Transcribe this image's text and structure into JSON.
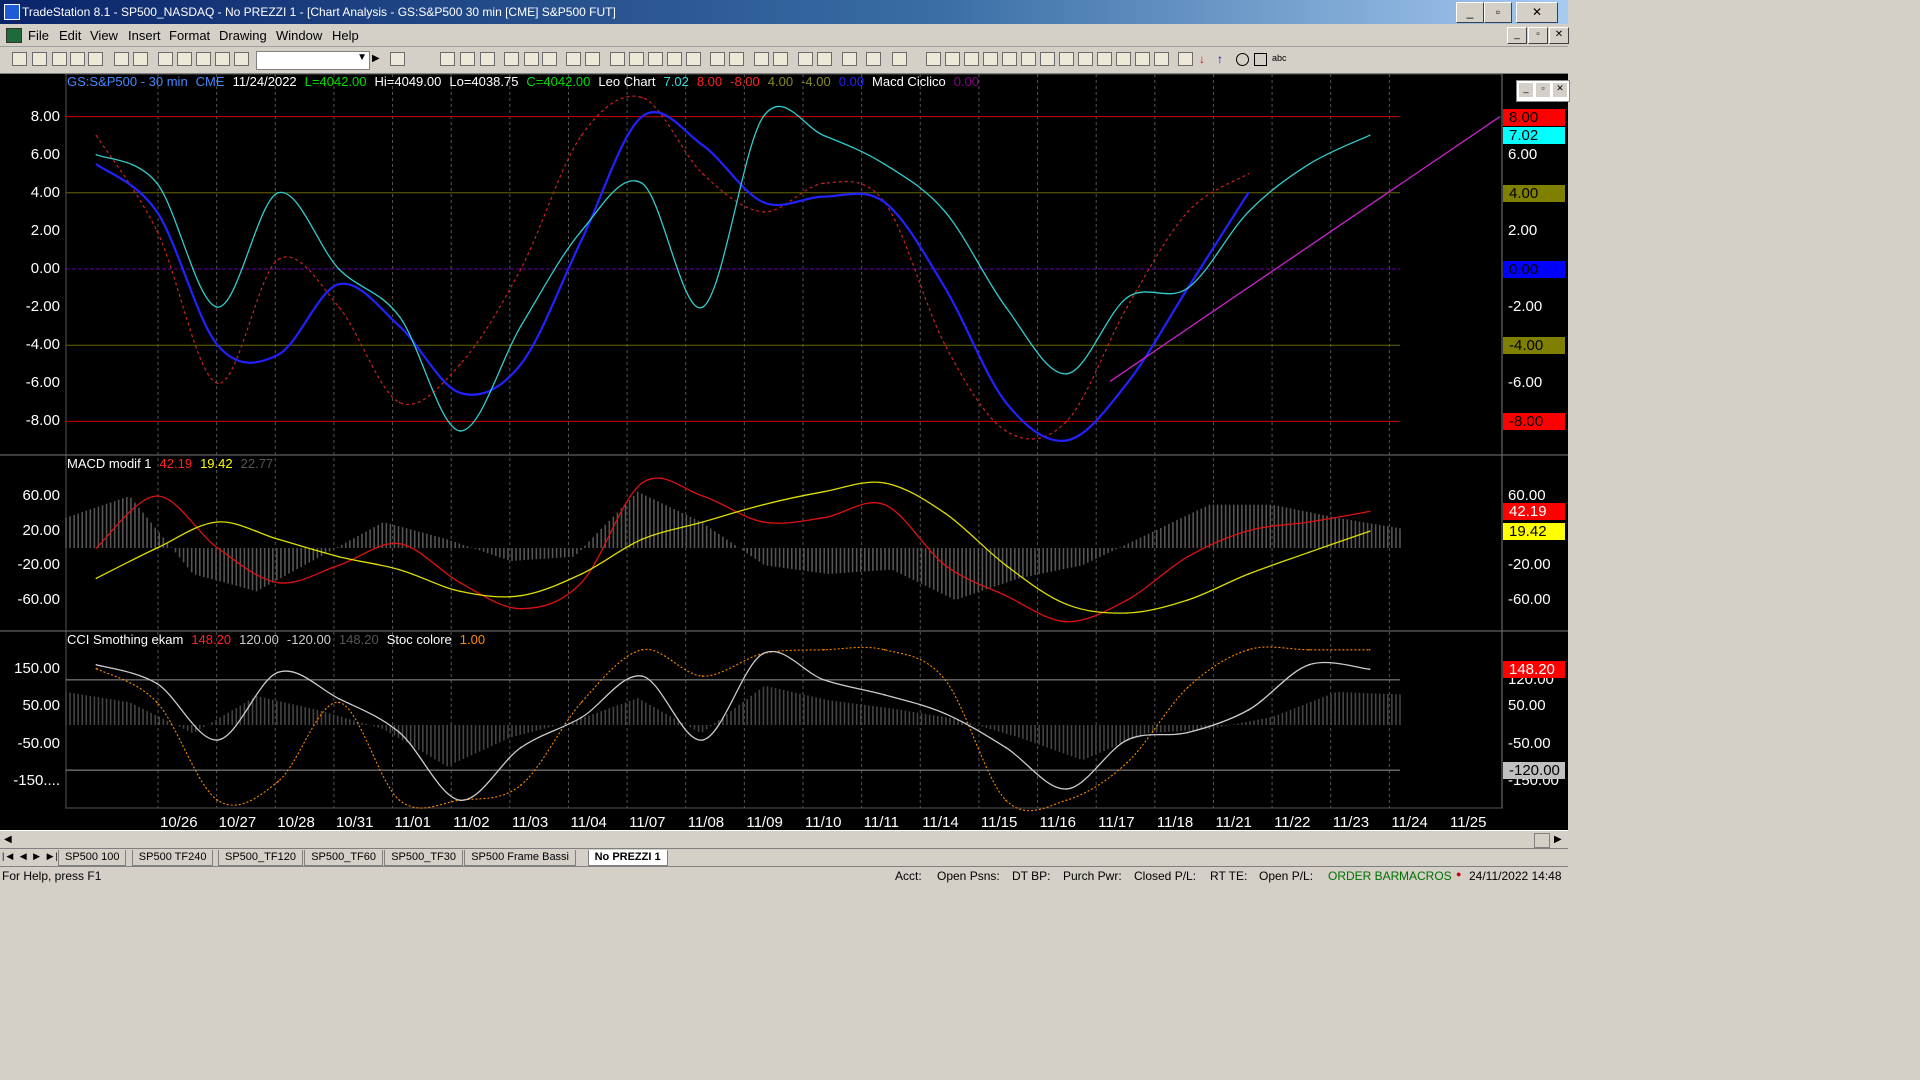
{
  "window": {
    "title": "TradeStation 8.1 - SP500_NASDAQ - No PREZZI 1 - [Chart Analysis - GS:S&P500  30 min  [CME] S&P500 FUT]"
  },
  "menu": [
    "File",
    "Edit",
    "View",
    "Insert",
    "Format",
    "Drawing",
    "Window",
    "Help"
  ],
  "pane1": {
    "labels": [
      {
        "text": "GS:S&P500 - 30 min",
        "color": "#4488ff"
      },
      {
        "text": "CME",
        "color": "#4488ff"
      },
      {
        "text": "11/24/2022",
        "color": "#ffffff"
      },
      {
        "text": "L=4042.00",
        "color": "#00dd00"
      },
      {
        "text": "Hi=4049.00",
        "color": "#ffffff"
      },
      {
        "text": "Lo=4038.75",
        "color": "#ffffff"
      },
      {
        "text": "C=4042.00",
        "color": "#00dd00"
      },
      {
        "text": "Leo Chart",
        "color": "#ffffff"
      },
      {
        "text": "7.02",
        "color": "#33dddd"
      },
      {
        "text": "8.00",
        "color": "#ff2222"
      },
      {
        "text": "-8.00",
        "color": "#ff2222"
      },
      {
        "text": "4.00",
        "color": "#888822"
      },
      {
        "text": "-4.00",
        "color": "#888822"
      },
      {
        "text": "0.00",
        "color": "#2222ff"
      },
      {
        "text": "Macd Ciclico",
        "color": "#ffffff"
      },
      {
        "text": "0.00",
        "color": "#880088"
      }
    ],
    "y_ticks": [
      "8.00",
      "6.00",
      "4.00",
      "2.00",
      "0.00",
      "-2.00",
      "-4.00",
      "-6.00",
      "-8.00"
    ],
    "right_ticks": [
      "6.00",
      "2.00",
      "-2.00",
      "-6.00"
    ],
    "tags": [
      {
        "text": "8.00",
        "bg": "#ff0000",
        "fg": "#000000"
      },
      {
        "text": "7.02",
        "bg": "#00ffff",
        "fg": "#000000"
      },
      {
        "text": "4.00",
        "bg": "#808000",
        "fg": "#000000"
      },
      {
        "text": "0.00",
        "bg": "#0000ff",
        "fg": "#000000"
      },
      {
        "text": "-4.00",
        "bg": "#808000",
        "fg": "#000000"
      },
      {
        "text": "-8.00",
        "bg": "#ff0000",
        "fg": "#000000"
      }
    ]
  },
  "pane2": {
    "labels": [
      {
        "text": "MACD modif 1",
        "color": "#ffffff"
      },
      {
        "text": "42.19",
        "color": "#ff2222"
      },
      {
        "text": "19.42",
        "color": "#ffff00"
      },
      {
        "text": "22.77",
        "color": "#555555"
      }
    ],
    "y_ticks": [
      "60.00",
      "20.00",
      "-20.00",
      "-60.00"
    ],
    "right_ticks": [
      "60.00",
      "-20.00",
      "-60.00"
    ],
    "tags": [
      {
        "text": "42.19",
        "bg": "#ff0000",
        "fg": "#ffffff"
      },
      {
        "text": "19.42",
        "bg": "#ffff00",
        "fg": "#000000"
      }
    ]
  },
  "pane3": {
    "labels": [
      {
        "text": "CCI Smothing ekam",
        "color": "#ffffff"
      },
      {
        "text": "148.20",
        "color": "#ff2222"
      },
      {
        "text": "120.00",
        "color": "#cccccc"
      },
      {
        "text": "-120.00",
        "color": "#cccccc"
      },
      {
        "text": "148.20",
        "color": "#555555"
      },
      {
        "text": "Stoc colore",
        "color": "#ffffff"
      },
      {
        "text": "1.00",
        "color": "#ff8800"
      }
    ],
    "y_ticks": [
      "150.00",
      "50.00",
      "-50.00",
      "-150...."
    ],
    "right_ticks": [
      "120.00",
      "50.00",
      "-50.00",
      "-150.00"
    ],
    "tags": [
      {
        "text": "148.20",
        "bg": "#ff0000",
        "fg": "#ffffff"
      },
      {
        "text": "-120.00",
        "bg": "#c0c0c0",
        "fg": "#000000"
      }
    ]
  },
  "dates": [
    "10/26",
    "10/27",
    "10/28",
    "10/31",
    "11/01",
    "11/02",
    "11/03",
    "11/04",
    "11/07",
    "11/08",
    "11/09",
    "11/10",
    "11/11",
    "11/14",
    "11/15",
    "11/16",
    "11/17",
    "11/18",
    "11/21",
    "11/22",
    "11/23",
    "11/24",
    "11/25"
  ],
  "tabs": [
    {
      "label": "SP500 100",
      "active": false
    },
    {
      "label": "SP500 TF240",
      "active": false
    },
    {
      "label": "SP500_TF120",
      "active": false
    },
    {
      "label": "SP500_TF60",
      "active": false
    },
    {
      "label": "SP500_TF30",
      "active": false
    },
    {
      "label": "SP500 Frame Bassi",
      "active": false
    },
    {
      "label": "No PREZZI 1",
      "active": true
    }
  ],
  "status": {
    "help": "For Help, press F1",
    "fields": [
      "Acct:",
      "Open Psns:",
      "DT BP:",
      "Purch Pwr:",
      "Closed P/L:",
      "RT TE:",
      "Open P/L:"
    ],
    "order_bar": "ORDER BAR",
    "macros": "MACROS",
    "datetime": "24/11/2022 14:48"
  },
  "chart_data": [
    {
      "type": "line",
      "title": "Leo Chart / Macd Ciclico",
      "x": [
        "10/26",
        "10/27",
        "10/28",
        "10/31",
        "11/01",
        "11/02",
        "11/03",
        "11/04",
        "11/07",
        "11/08",
        "11/09",
        "11/10",
        "11/11",
        "11/14",
        "11/15",
        "11/16",
        "11/17",
        "11/18",
        "11/21",
        "11/22",
        "11/23",
        "11/24"
      ],
      "ylim": [
        -9.5,
        9.5
      ],
      "levels": [
        8,
        4,
        0,
        -4,
        -8
      ],
      "series": [
        {
          "name": "Leo Chart",
          "color": "#33cccc",
          "values": [
            6.0,
            4.5,
            -2.0,
            4.0,
            0.0,
            -2.5,
            -8.5,
            -3.0,
            2.0,
            4.5,
            -2.0,
            8.0,
            7.0,
            5.5,
            3.0,
            -2.0,
            -5.5,
            -1.5,
            -1.0,
            3.0,
            5.5,
            7.02
          ]
        },
        {
          "name": "Macd Ciclico",
          "color": "#2222ff",
          "values": [
            5.5,
            3.0,
            -4.0,
            -4.5,
            -0.8,
            -3.0,
            -6.5,
            -5.0,
            1.5,
            8.0,
            6.5,
            3.5,
            3.8,
            3.5,
            -1.0,
            -7.0,
            -9.0,
            -6.0,
            -1.0,
            4.0,
            null,
            null
          ]
        },
        {
          "name": "signal",
          "color": "#cc2222",
          "values": [
            7.0,
            2.0,
            -6.0,
            0.5,
            -2.0,
            -7.0,
            -5.0,
            0.0,
            7.0,
            9.0,
            5.0,
            3.0,
            4.5,
            3.5,
            -4.0,
            -8.5,
            -8.0,
            -2.0,
            3.0,
            5.0,
            null,
            null
          ]
        }
      ]
    },
    {
      "type": "line",
      "title": "MACD modif 1",
      "x": [
        "10/26",
        "10/27",
        "10/28",
        "10/31",
        "11/01",
        "11/02",
        "11/03",
        "11/04",
        "11/07",
        "11/08",
        "11/09",
        "11/10",
        "11/11",
        "11/14",
        "11/15",
        "11/16",
        "11/17",
        "11/18",
        "11/21",
        "11/22",
        "11/23",
        "11/24"
      ],
      "ylim": [
        -90,
        90
      ],
      "series": [
        {
          "name": "MACD",
          "color": "#dd1111",
          "values": [
            0,
            60,
            0,
            -40,
            -20,
            5,
            -40,
            -70,
            -40,
            75,
            60,
            30,
            35,
            50,
            -20,
            -55,
            -85,
            -60,
            -10,
            20,
            30,
            42.19
          ]
        },
        {
          "name": "Signal",
          "color": "#dddd00",
          "values": [
            -35,
            0,
            30,
            10,
            -10,
            -25,
            -50,
            -55,
            -30,
            10,
            30,
            50,
            65,
            75,
            40,
            -20,
            -65,
            -75,
            -60,
            -30,
            -5,
            19.42
          ]
        },
        {
          "name": "Histogram",
          "color": "#555555",
          "values": [
            35,
            60,
            -30,
            -50,
            -10,
            30,
            10,
            -15,
            -10,
            65,
            30,
            -20,
            -30,
            -25,
            -60,
            -35,
            -20,
            15,
            50,
            50,
            35,
            22.77
          ]
        }
      ]
    },
    {
      "type": "line",
      "title": "CCI Smothing ekam / Stoc colore",
      "x": [
        "10/26",
        "10/27",
        "10/28",
        "10/31",
        "11/01",
        "11/02",
        "11/03",
        "11/04",
        "11/07",
        "11/08",
        "11/09",
        "11/10",
        "11/11",
        "11/14",
        "11/15",
        "11/16",
        "11/17",
        "11/18",
        "11/21",
        "11/22",
        "11/23",
        "11/24"
      ],
      "ylim": [
        -210,
        210
      ],
      "levels": [
        120,
        -120
      ],
      "series": [
        {
          "name": "CCI",
          "color": "#cccccc",
          "values": [
            160,
            110,
            -40,
            140,
            70,
            -20,
            -200,
            -60,
            20,
            130,
            -40,
            190,
            120,
            80,
            30,
            -60,
            -170,
            -40,
            -20,
            40,
            160,
            148.2
          ]
        },
        {
          "name": "Stoc",
          "color": "#ff8800",
          "values": [
            150,
            60,
            -200,
            -150,
            60,
            -200,
            -200,
            -160,
            60,
            200,
            130,
            190,
            200,
            200,
            120,
            -200,
            -200,
            -100,
            100,
            200,
            200,
            200
          ]
        }
      ]
    }
  ]
}
